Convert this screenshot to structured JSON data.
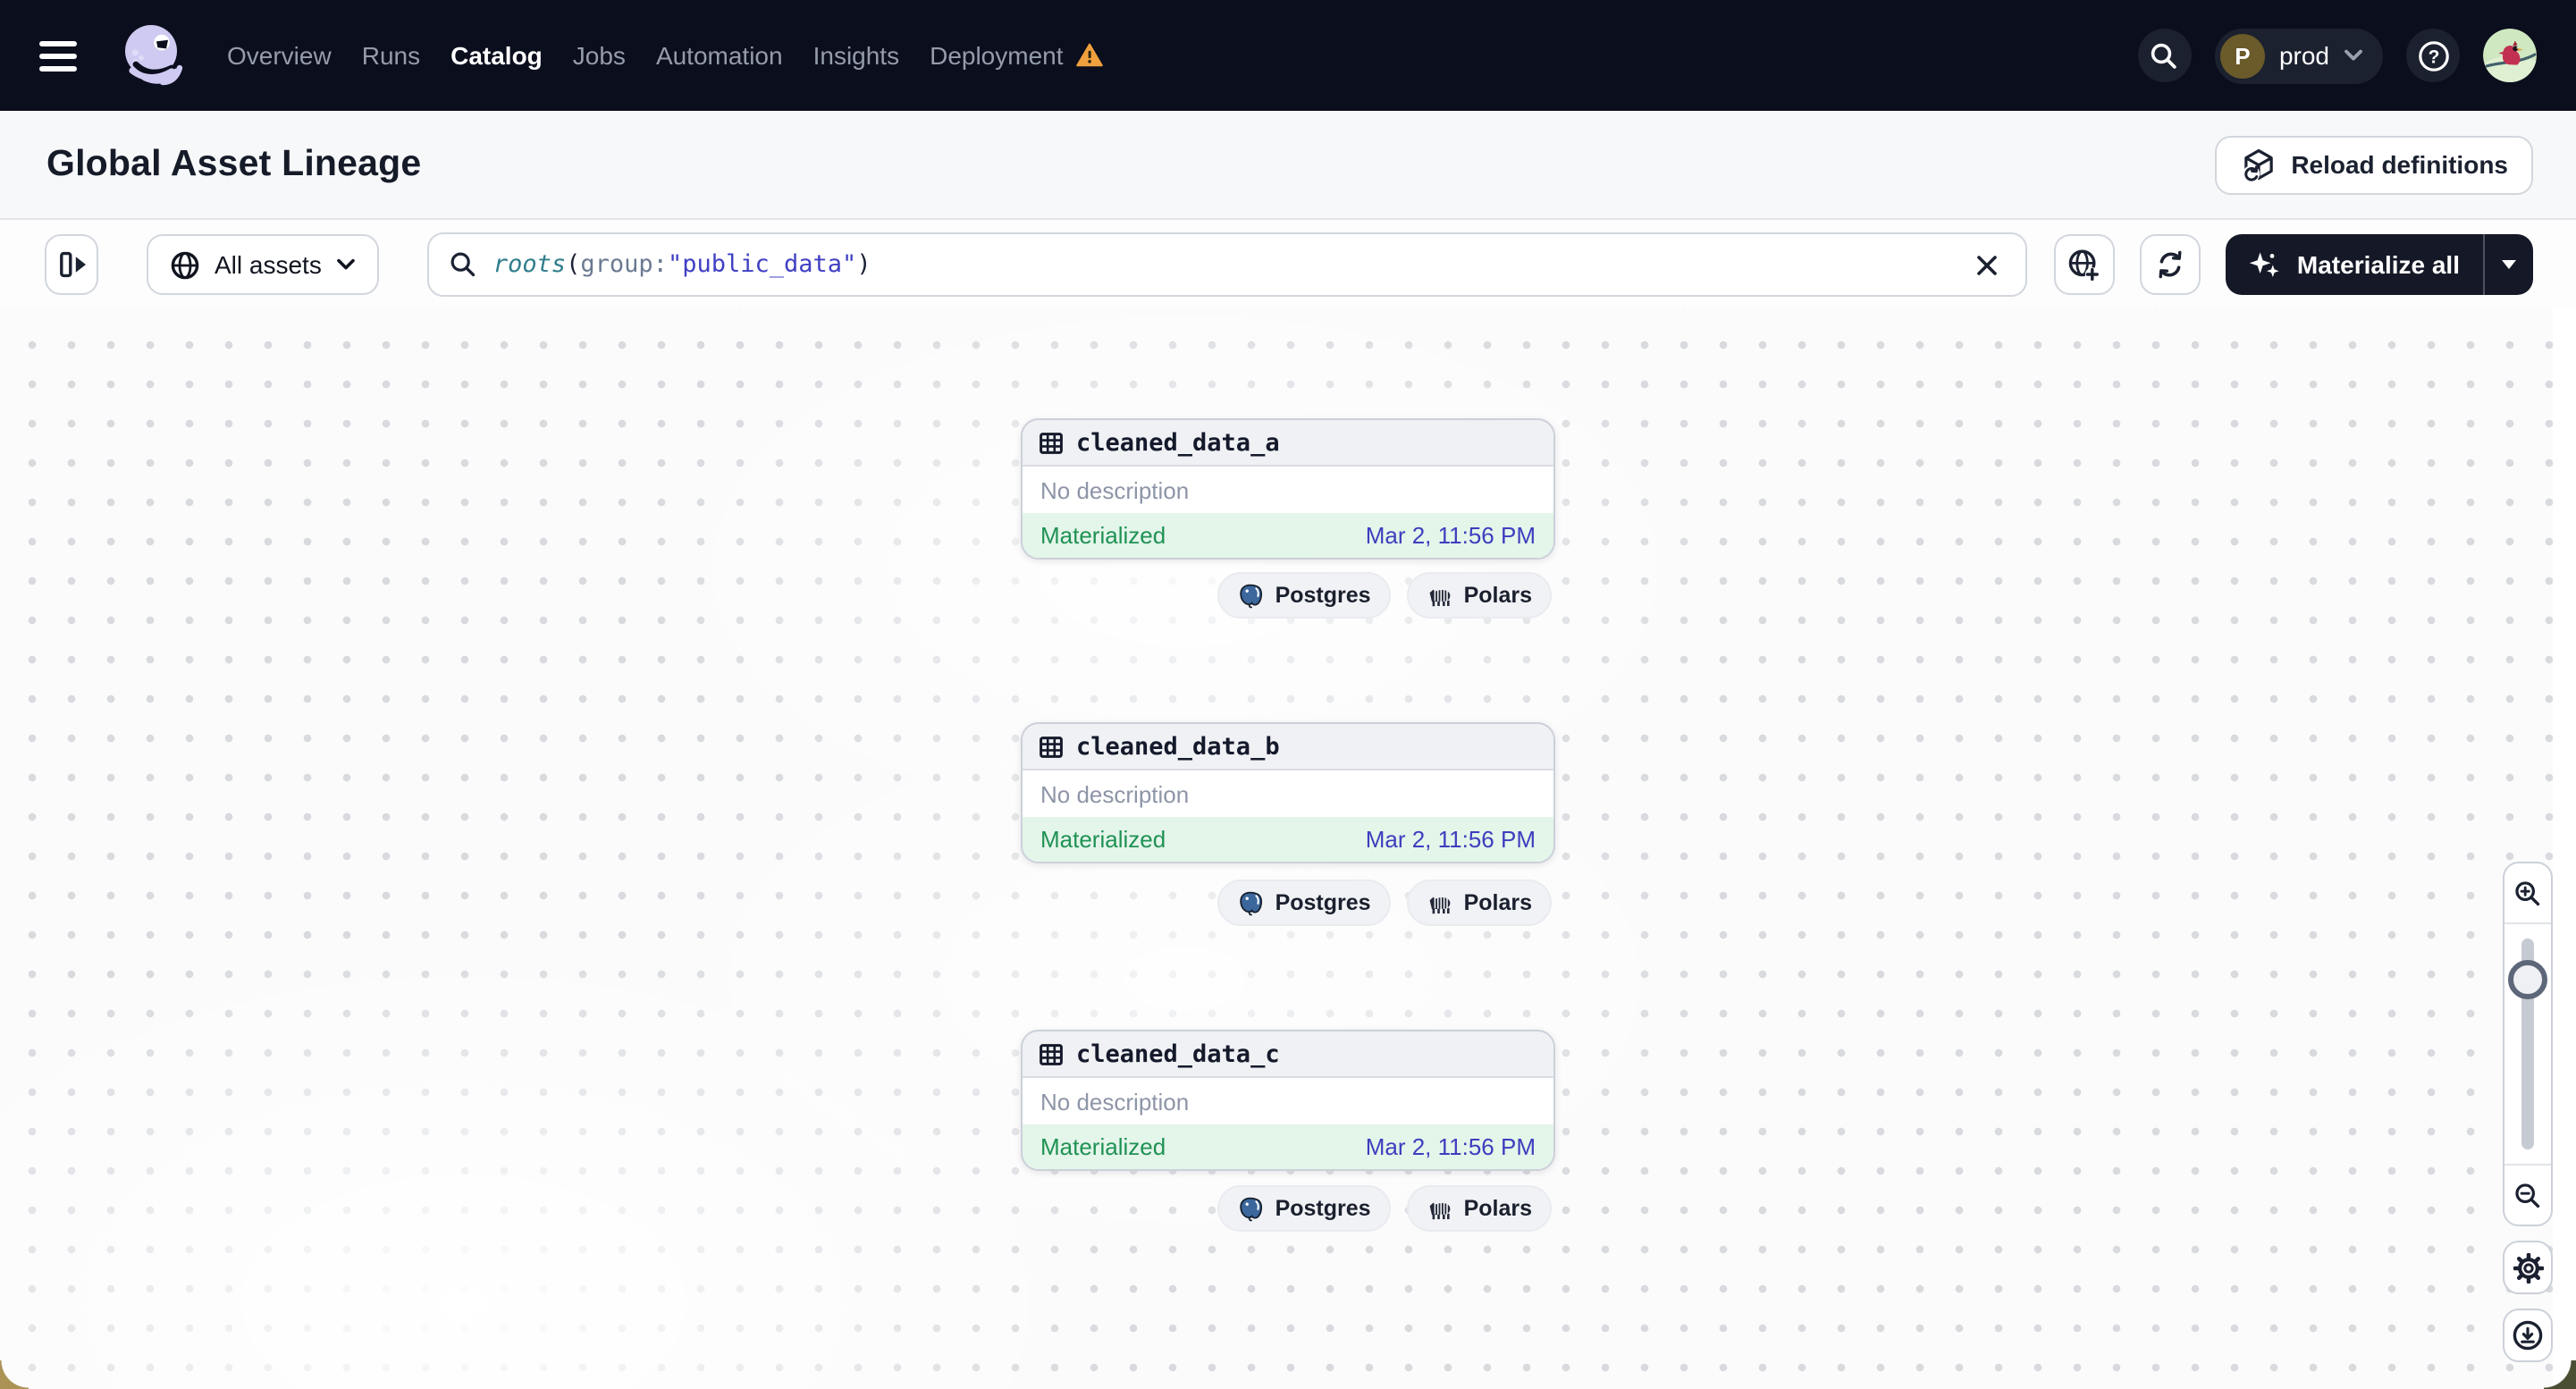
{
  "topnav": {
    "nav_items": [
      "Overview",
      "Runs",
      "Catalog",
      "Jobs",
      "Automation",
      "Insights",
      "Deployment"
    ],
    "active_item": "Catalog",
    "workspace": {
      "initial": "P",
      "name": "prod"
    }
  },
  "header": {
    "title": "Global Asset Lineage",
    "reload_button": "Reload definitions"
  },
  "toolbar": {
    "filter_button": "All assets",
    "query": {
      "fn": "roots",
      "open": "(",
      "field": "group:",
      "value": "\"public_data\"",
      "close": ")"
    },
    "materialize_button": "Materialize all"
  },
  "graph": {
    "nodes": [
      {
        "name": "cleaned_data_a",
        "description": "No description",
        "status": "Materialized",
        "timestamp": "Mar 2, 11:56 PM",
        "tags": [
          "Postgres",
          "Polars"
        ]
      },
      {
        "name": "cleaned_data_b",
        "description": "No description",
        "status": "Materialized",
        "timestamp": "Mar 2, 11:56 PM",
        "tags": [
          "Postgres",
          "Polars"
        ]
      },
      {
        "name": "cleaned_data_c",
        "description": "No description",
        "status": "Materialized",
        "timestamp": "Mar 2, 11:56 PM",
        "tags": [
          "Postgres",
          "Polars"
        ]
      }
    ]
  },
  "colors": {
    "nav_bg": "#0b0e1d",
    "status_green": "#1f9254",
    "timestamp_indigo": "#3e3ebe",
    "warning_orange": "#efa13e",
    "query_fn_teal": "#2f7d8c",
    "query_value_indigo": "#3f3fc3"
  }
}
